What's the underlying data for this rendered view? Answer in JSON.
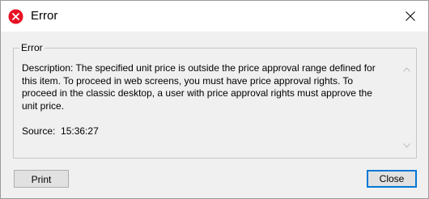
{
  "window": {
    "title": "Error",
    "title_icon": "error-icon",
    "close_icon": "close-icon"
  },
  "group": {
    "legend": "Error",
    "description": "Description: The specified unit price is outside the price approval range defined for this item. To proceed in web screens, you must have price approval rights. To proceed in the classic desktop, a user with price approval rights must approve the unit price.",
    "source_label": "Source:",
    "source_value": "15:36:27"
  },
  "buttons": {
    "print_label": "Print",
    "close_label": "Close"
  },
  "colors": {
    "error_red": "#e81123",
    "accent": "#0078d7",
    "window_bg": "#f0f0f0"
  }
}
